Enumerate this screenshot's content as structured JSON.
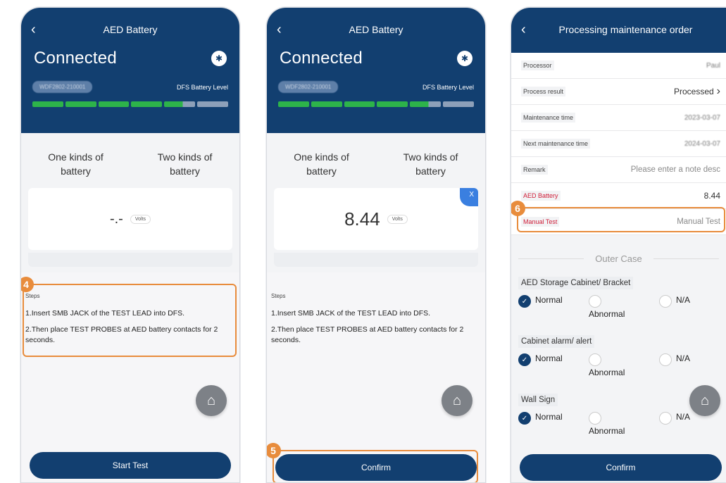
{
  "screens": [
    {
      "title": "AED Battery",
      "status": "Connected",
      "device_id": "WDF2802-210001",
      "battery_level_label": "DFS Battery Level",
      "tabs": [
        "One kinds of battery",
        "Two kinds of battery"
      ],
      "reading": "-.-",
      "unit": "Volts",
      "steps_title": "Steps",
      "steps": [
        "1.Insert SMB JACK of the TEST LEAD into DFS.",
        "2.Then place TEST PROBES at AED battery contacts for 2 seconds."
      ],
      "callout": "4",
      "button": "Start Test"
    },
    {
      "title": "AED Battery",
      "status": "Connected",
      "device_id": "WDF2802-210001",
      "battery_level_label": "DFS Battery Level",
      "tabs": [
        "One kinds of battery",
        "Two kinds of battery"
      ],
      "reading": "8.44",
      "unit": "Volts",
      "corner_badge": "X",
      "steps_title": "Steps",
      "steps": [
        "1.Insert SMB JACK of the TEST LEAD into DFS.",
        "2.Then place TEST PROBES at AED battery contacts for 2 seconds."
      ],
      "callout": "5",
      "button": "Confirm"
    },
    {
      "title": "Processing maintenance order",
      "rows": [
        {
          "label": "Processor",
          "value": "Paul"
        },
        {
          "label": "Process result",
          "value": "Processed"
        },
        {
          "label": "Maintenance time",
          "value": "2023-03-07"
        },
        {
          "label": "Next maintenance time",
          "value": "2024-03-07"
        },
        {
          "label": "Remark",
          "value": "Please enter a note desc"
        },
        {
          "label": "AED Battery",
          "value": "8.44"
        },
        {
          "label": "Manual Test",
          "value": "Manual Test"
        }
      ],
      "callout": "6",
      "section": "Outer Case",
      "groups": [
        {
          "label": "AED Storage Cabinet/ Bracket",
          "options": [
            "Normal",
            "Abnormal",
            "N/A"
          ]
        },
        {
          "label": "Cabinet alarm/ alert",
          "options": [
            "Normal",
            "Abnormal",
            "N/A"
          ]
        },
        {
          "label": "Wall Sign",
          "options": [
            "Normal",
            "Abnormal",
            "N/A"
          ]
        }
      ],
      "button": "Confirm"
    }
  ],
  "colors": {
    "header": "#123f70",
    "battery_green": "#2db34a",
    "callout_orange": "#e88c3c",
    "required_red": "#d0203a"
  }
}
